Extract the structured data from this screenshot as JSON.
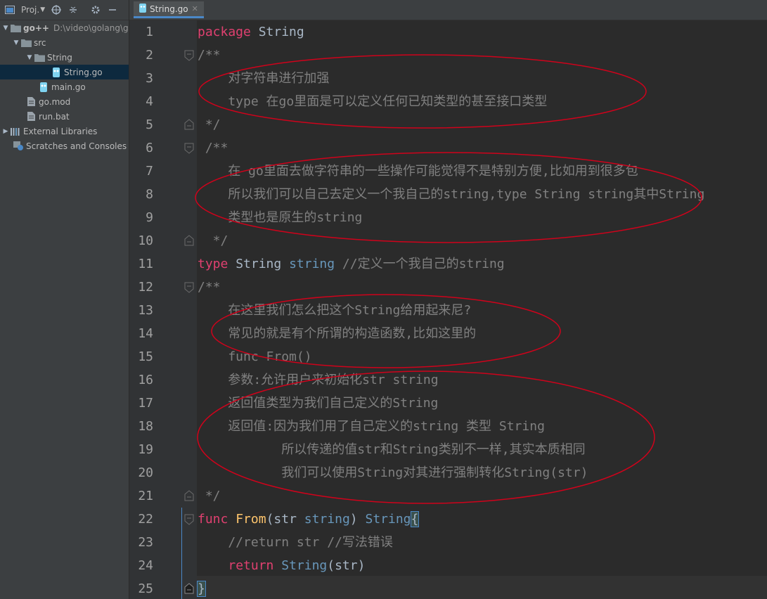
{
  "sidebar": {
    "toolbar": {
      "project_label": "Proj.",
      "icons": [
        "project-icon",
        "target-icon",
        "collapse-icon",
        "gear-icon",
        "minimize-icon"
      ]
    },
    "tree": [
      {
        "label": "go++",
        "path": "D:\\video\\golang\\g",
        "icon": "folder-icon",
        "expanded": true
      },
      {
        "label": "src",
        "icon": "folder-icon",
        "expanded": true
      },
      {
        "label": "String",
        "icon": "folder-icon",
        "expanded": true
      },
      {
        "label": "String.go",
        "icon": "go-file-icon",
        "selected": true
      },
      {
        "label": "main.go",
        "icon": "go-file-icon"
      },
      {
        "label": "go.mod",
        "icon": "file-icon"
      },
      {
        "label": "run.bat",
        "icon": "file-icon"
      },
      {
        "label": "External Libraries",
        "icon": "library-icon",
        "expanded": false
      },
      {
        "label": "Scratches and Consoles",
        "icon": "scratches-icon"
      }
    ]
  },
  "tabs": [
    {
      "label": "String.go",
      "active": true,
      "icon": "go-file-icon"
    }
  ],
  "colors": {
    "background": "#2b2b2b",
    "keyword": "#cc7832",
    "type": "#6897bb",
    "function": "#ffc66d",
    "comment": "#808080",
    "annotation": "#d0021b",
    "func_keyword_pink": "#e04070"
  },
  "editor": {
    "line_numbers": [
      "1",
      "2",
      "3",
      "4",
      "5",
      "6",
      "7",
      "8",
      "9",
      "10",
      "11",
      "12",
      "13",
      "14",
      "15",
      "16",
      "17",
      "18",
      "19",
      "20",
      "21",
      "22",
      "23",
      "24",
      "25"
    ],
    "lines": {
      "l1": {
        "kw": "package",
        "rest": " String"
      },
      "l2": "/**",
      "l3": "    对字符串进行加强",
      "l4": "    type 在go里面是可以定义任何已知类型的甚至接口类型",
      "l5": " */",
      "l6": " /**",
      "l7": "    在 go里面去做字符串的一些操作可能觉得不是特别方便,比如用到很多包",
      "l8": "    所以我们可以自己去定义一个我自己的string,type String string其中String",
      "l9": "    类型也是原生的string",
      "l10": "  */",
      "l11": {
        "kw": "type",
        "name": " String ",
        "typ": "string",
        "comment": " //定义一个我自己的string"
      },
      "l12": "/**",
      "l13": "    在这里我们怎么把这个String给用起来尼?",
      "l14": "    常见的就是有个所谓的构造函数,比如这里的",
      "l15": "    func From()",
      "l16": "    参数:允许用户来初始化str string",
      "l17": "    返回值类型为我们自己定义的String",
      "l18": "    返回值:因为我们用了自己定义的string 类型 String",
      "l19": "           所以传递的值str和String类别不一样,其实本质相同",
      "l20": "           我们可以使用String对其进行强制转化String(str)",
      "l21": " */",
      "l22": {
        "kw": "func",
        "fn": "From",
        "open": "(",
        "param": "str",
        "typ1": "string",
        "close": ") ",
        "ret": "String",
        "brace": "{"
      },
      "l23": "    //return str //写法错误",
      "l24": {
        "indent": "    ",
        "kw": "return",
        "typ": " String",
        "rest": "(str)"
      },
      "l25": "}"
    }
  }
}
